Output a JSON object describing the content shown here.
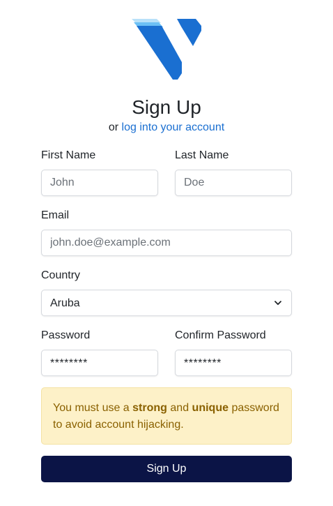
{
  "brand": {
    "logo_icon": "vultr-logo-icon",
    "colors": {
      "primary": "#1a6fd1",
      "light": "#4aa3f0",
      "lightest": "#9cd3f7"
    }
  },
  "header": {
    "title": "Sign Up",
    "subtitle_prefix": "or",
    "login_link": "log into your account"
  },
  "form": {
    "first_name": {
      "label": "First Name",
      "placeholder": "John"
    },
    "last_name": {
      "label": "Last Name",
      "placeholder": "Doe"
    },
    "email": {
      "label": "Email",
      "placeholder": "john.doe@example.com"
    },
    "country": {
      "label": "Country",
      "value": "Aruba",
      "icon": "chevron-down-icon"
    },
    "password": {
      "label": "Password",
      "value": "********"
    },
    "confirm_password": {
      "label": "Confirm Password",
      "value": "********"
    }
  },
  "alert": {
    "text_1": "You must use a",
    "strong_1": "strong",
    "text_2": "and",
    "strong_2": "unique",
    "text_3": "password to avoid account hijacking."
  },
  "submit": {
    "label": "Sign Up",
    "color": "#0b1446"
  }
}
